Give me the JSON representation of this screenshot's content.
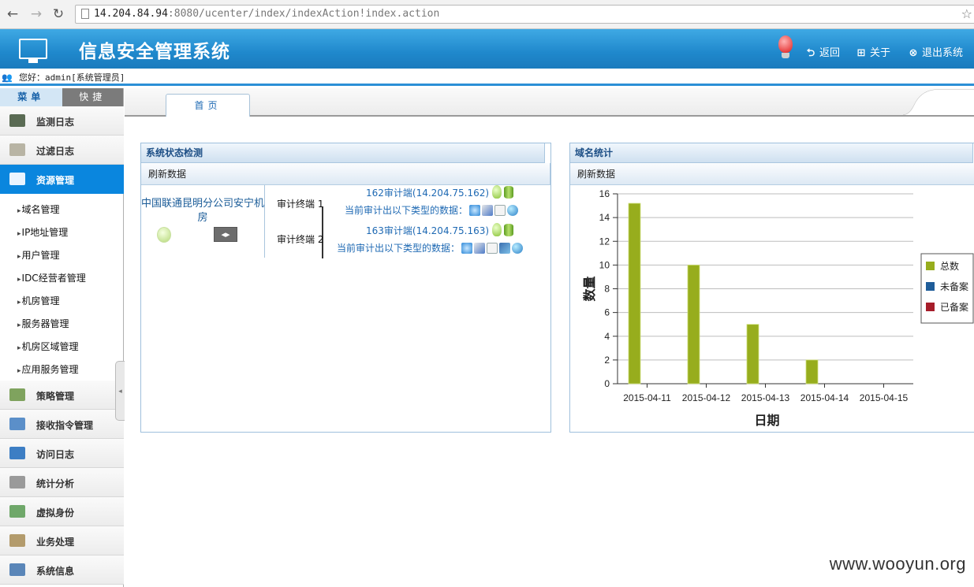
{
  "browser": {
    "url_host": "14.204.84.94",
    "url_rest": ":8080/ucenter/index/indexAction!index.action"
  },
  "header": {
    "title": "信息安全管理系统",
    "links": [
      {
        "label": "返回",
        "icon": "back-icon"
      },
      {
        "label": "关于",
        "icon": "windows-icon"
      },
      {
        "label": "退出系统",
        "icon": "close-circle-icon"
      }
    ]
  },
  "welcome": {
    "text": "您好：admin[系统管理员]"
  },
  "sidebar": {
    "tabs": [
      "菜单",
      "快捷"
    ],
    "modules": [
      {
        "label": "监测日志",
        "icon": "monitor-log-icon",
        "color": "#5a6b54"
      },
      {
        "label": "过滤日志",
        "icon": "envelope-icon",
        "color": "#b8b4a4"
      },
      {
        "label": "资源管理",
        "icon": "network-icon",
        "color": "#eaf4ff",
        "active": true
      },
      {
        "label": "策略管理",
        "icon": "strategy-icon",
        "color": "#7fa35e"
      },
      {
        "label": "接收指令管理",
        "icon": "receive-command-icon",
        "color": "#5b8fc9"
      },
      {
        "label": "访问日志",
        "icon": "access-log-icon",
        "color": "#3d7ec4"
      },
      {
        "label": "统计分析",
        "icon": "statistics-icon",
        "color": "#9a9a9a"
      },
      {
        "label": "虚拟身份",
        "icon": "virtual-identity-icon",
        "color": "#6fa86a"
      },
      {
        "label": "业务处理",
        "icon": "business-icon",
        "color": "#b39b6c"
      },
      {
        "label": "系统信息",
        "icon": "system-info-icon",
        "color": "#5a86b8"
      }
    ],
    "sub_items": [
      "域名管理",
      "IP地址管理",
      "用户管理",
      "IDC经营者管理",
      "机房管理",
      "服务器管理",
      "机房区域管理",
      "应用服务管理"
    ]
  },
  "tabs": {
    "home": "首页"
  },
  "status_panel": {
    "title": "系统状态检测",
    "refresh": "刷新数据",
    "room": "中国联通昆明分公司安宁机房",
    "terminals": [
      {
        "label": "审计终端 1",
        "auditor": "162审计端(14.204.75.162)",
        "data_label": "当前审计出以下类型的数据：",
        "icons": [
          "ie-icon",
          "cd-icon",
          "document-icon",
          "globe-icon"
        ]
      },
      {
        "label": "审计终端 2",
        "auditor": "163审计端(14.204.75.163)",
        "data_label": "当前审计出以下类型的数据：",
        "icons": [
          "ie-icon",
          "cd-icon",
          "document-icon",
          "network-node-icon",
          "globe-icon"
        ]
      }
    ]
  },
  "domain_panel": {
    "title": "域名统计",
    "refresh": "刷新数据"
  },
  "chart_data": {
    "type": "bar",
    "categories": [
      "2015-04-11",
      "2015-04-12",
      "2015-04-13",
      "2015-04-14",
      "2015-04-15"
    ],
    "series": [
      {
        "name": "总数",
        "values": [
          15.2,
          10,
          5,
          2,
          0
        ],
        "color": "#97ad1d"
      },
      {
        "name": "未备案",
        "values": [
          0,
          0,
          0,
          0,
          0
        ],
        "color": "#1f5d99"
      },
      {
        "name": "已备案",
        "values": [
          0,
          0,
          0,
          0,
          0
        ],
        "color": "#a61d2a"
      }
    ],
    "xlabel": "日期",
    "ylabel": "数量",
    "ylim": [
      0,
      16
    ],
    "yticks": [
      0,
      2,
      4,
      6,
      8,
      10,
      12,
      14,
      16
    ],
    "grid": true,
    "legend": "right"
  },
  "watermark": "www.wooyun.org"
}
